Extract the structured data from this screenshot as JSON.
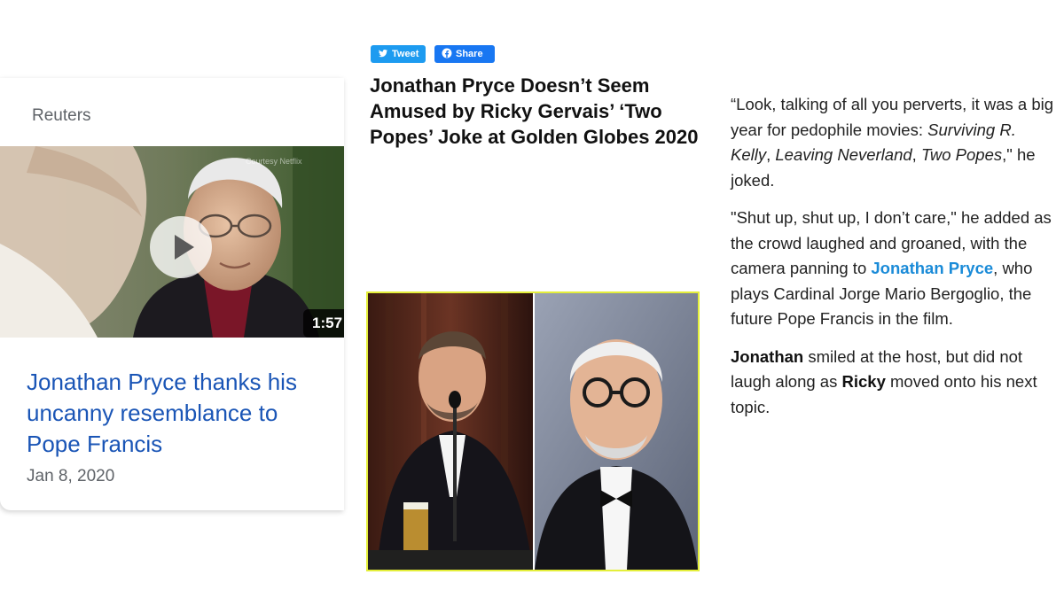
{
  "card": {
    "source": "Reuters",
    "courtesy": "Courtesy Netflix",
    "duration": "1:57",
    "title": "Jonathan Pryce thanks his uncanny resemblance to Pope Francis",
    "date": "Jan 8, 2020"
  },
  "article": {
    "tweet_label": "Tweet",
    "share_label": "Share",
    "title": "Jonathan Pryce Doesn’t Seem Amused by Ricky Gervais’ ‘Two Popes’ Joke at Golden Globes 2020"
  },
  "quote": {
    "p1_a": "“Look, talking of all you perverts, it was a big year for pedophile movies: ",
    "p1_film1": "Surviving R. Kelly",
    "p1_sep1": ", ",
    "p1_film2": "Leaving Neverland",
    "p1_sep2": ", ",
    "p1_film3": "Two Popes",
    "p1_end": ",\" he joked.",
    "p2_a": "\"Shut up, shut up, I don’t care,\" he added as the crowd laughed and groaned, with the camera panning to ",
    "p2_link": "Jonathan Pryce",
    "p2_b": ", who plays Cardinal Jorge Mario Bergoglio, the future Pope Francis in the film.",
    "p3_name1": "Jonathan",
    "p3_a": " smiled at the host, but did not laugh along as ",
    "p3_name2": "Ricky",
    "p3_b": " moved onto his next topic."
  },
  "colors": {
    "link_blue": "#1a55b6",
    "quote_link": "#1a8bd8",
    "tweet_blue": "#1d9bf0",
    "facebook_blue": "#1877f2",
    "photo_border": "#e4ef3a"
  },
  "icons": [
    "play-icon",
    "twitter-bird-icon",
    "facebook-icon"
  ]
}
